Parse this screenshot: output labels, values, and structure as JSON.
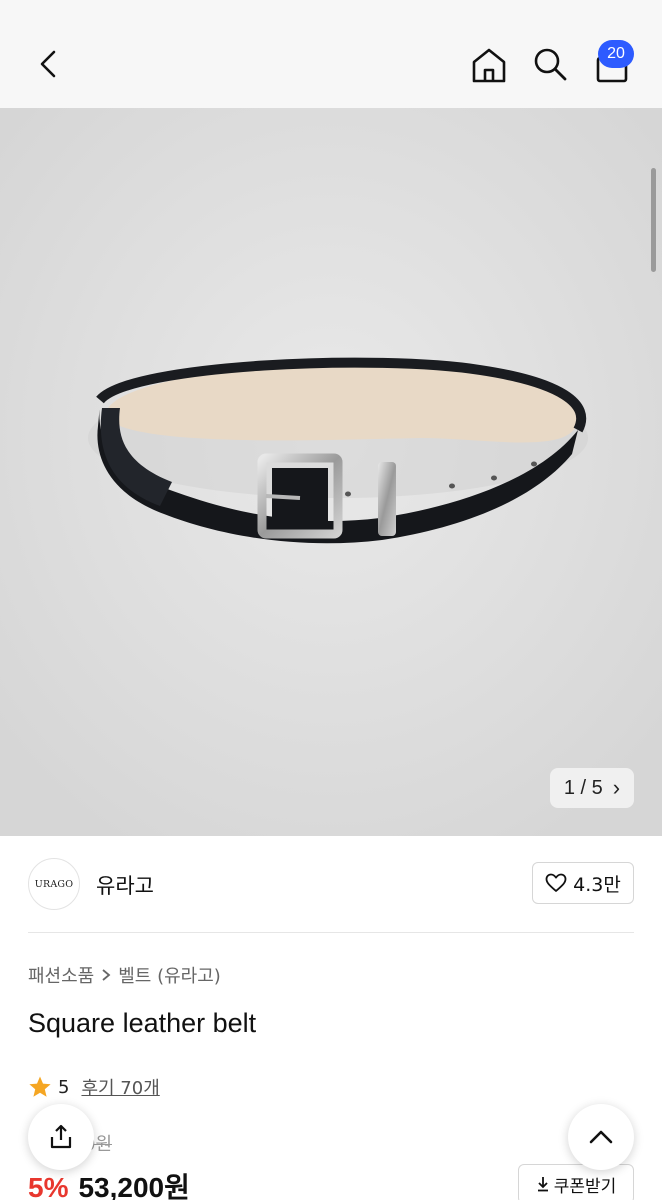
{
  "header": {
    "badge_count": "20",
    "icons": [
      "back-icon",
      "home-icon",
      "search-icon",
      "bag-icon"
    ]
  },
  "gallery": {
    "current": "1",
    "separator": "/",
    "total": "5",
    "next_glyph": "›"
  },
  "brand": {
    "logo_text": "URAGO",
    "name": "유라고",
    "like_count": "4.3만"
  },
  "product": {
    "breadcrumb": [
      "패션소품",
      "벨트 (유라고)"
    ],
    "title": "Square leather belt",
    "rating": "5",
    "review_label": "후기 70개",
    "original_price_visible": "0원",
    "discount": "5%",
    "price": "53,200원",
    "coupon_label": "쿠폰받기"
  },
  "colors": {
    "accent_blue": "#2d5bff",
    "discount_red": "#e8372e",
    "star": "#f5a623"
  }
}
